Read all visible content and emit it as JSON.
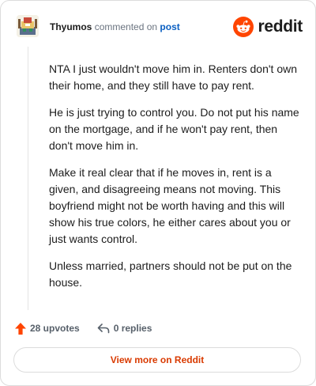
{
  "header": {
    "username": "Thyumos",
    "verb": "commented on",
    "post_link": "post",
    "brand": "reddit",
    "avatar_icon": "user-avatar",
    "brand_icon": "reddit-snoo-icon"
  },
  "comment": {
    "paragraphs": [
      "NTA I just wouldn't move him in. Renters don't own their home, and they still have to pay rent.",
      "He is just trying to control you. Do not put his name on the mortgage, and if he won't pay rent, then don't move him in.",
      "Make it real clear that if he moves in, rent is a given, and disagreeing means not moving. This boyfriend might not be worth having and this will show his true colors, he either cares about you or just wants control.",
      "Unless married, partners should not be put on the house."
    ]
  },
  "actions": {
    "upvotes": "28 upvotes",
    "replies": "0 replies",
    "upvote_icon": "upvote-arrow-icon",
    "reply_icon": "reply-arrow-icon"
  },
  "footer": {
    "view_more": "View more on Reddit"
  },
  "colors": {
    "brand": "#ff4500",
    "link": "#0a5fc2",
    "view_more_text": "#d93a00",
    "muted_text": "#57606a",
    "border": "#dcdcdc"
  }
}
